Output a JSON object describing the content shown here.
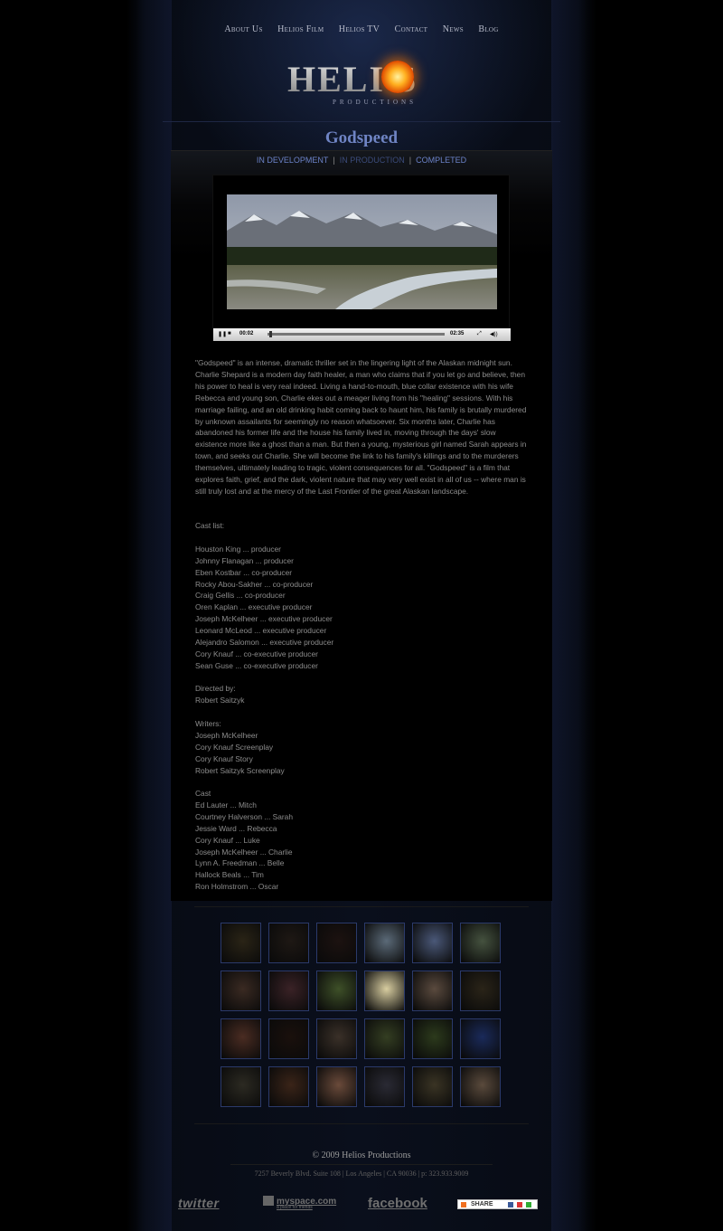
{
  "nav": {
    "items": [
      "About Us",
      "Helios Film",
      "Helios TV",
      "Contact",
      "News",
      "Blog"
    ]
  },
  "logo": {
    "word": "HELI  S",
    "sub": "PRODUCTIONS"
  },
  "page": {
    "title": "Godspeed"
  },
  "subnav": {
    "items": [
      "IN DEVELOPMENT",
      "IN PRODUCTION",
      "COMPLETED"
    ],
    "active_index": 1
  },
  "player": {
    "elapsed": "00:02",
    "duration": "02:35",
    "progress_fraction": 0.013
  },
  "description": "\"Godspeed\" is an intense, dramatic thriller set in the lingering light of the Alaskan midnight sun. Charlie Shepard is a modern day faith healer, a man who claims that if you let go and believe, then his power to heal is very real indeed. Living a hand-to-mouth, blue collar existence with his wife Rebecca and young son, Charlie ekes out a meager living from his \"healing\" sessions. With his marriage failing, and an old drinking habit coming back to haunt him, his family is brutally murdered by unknown assailants for seemingly no reason whatsoever. Six months later, Charlie has abandoned his former life and the house his family lived in, moving through the days' slow existence more like a ghost than a man. But then a young, mysterious girl named Sarah appears in town, and seeks out Charlie. She will become the link to his family's killings and to the murderers themselves, ultimately leading to tragic, violent consequences for all. \"Godspeed\" is a film that explores faith, grief, and the dark, violent nature that may very well exist in all of us -- where man is still truly lost and at the mercy of the Last Frontier of the great Alaskan landscape.",
  "cast_list": {
    "heading": "Cast list:",
    "items": [
      "Houston King ... producer",
      "Johnny Flanagan ... producer",
      "Eben Kostbar ... co-producer",
      "Rocky Abou-Sakher ... co-producer",
      "Craig Gellis ... co-producer",
      "Oren Kaplan ... executive producer",
      "Joseph McKelheer ... executive producer",
      "Leonard McLeod ... executive producer",
      "Alejandro Salomon ... executive producer",
      "Cory Knauf ... co-executive producer",
      "Sean Guse ... co-executive producer"
    ]
  },
  "directed": {
    "heading": "Directed by:",
    "items": [
      "Robert Saitzyk"
    ]
  },
  "writers": {
    "heading": "Writers:",
    "items": [
      "Joseph McKelheer",
      "Cory Knauf  Screenplay",
      "Cory Knauf  Story",
      "Robert Saitzyk  Screenplay"
    ]
  },
  "cast": {
    "heading": "Cast",
    "items": [
      "Ed Lauter ... Mitch",
      "Courtney Halverson ... Sarah",
      "Jessie Ward ... Rebecca",
      "Cory Knauf ... Luke",
      "Joseph McKelheer ... Charlie",
      "Lynn A. Freedman ... Belle",
      "Hallock Beals ... Tim",
      "Ron Holmstrom ... Oscar"
    ]
  },
  "gallery": {
    "colors": [
      [
        "#2a2416",
        "#1e1814",
        "#1c1210",
        "#5b6a78",
        "#4a5878",
        "#45523f"
      ],
      [
        "#3a2a22",
        "#3a2226",
        "#3e5028",
        "#d8cda0",
        "#5a4a3e",
        "#2a2418"
      ],
      [
        "#4a2c22",
        "#1a100c",
        "#3a3028",
        "#343e22",
        "#2c3a1c",
        "#1a2a5a"
      ],
      [
        "#2c2a22",
        "#3a2418",
        "#6a4a3a",
        "#2a2a34",
        "#3a3424",
        "#5a4a3c"
      ]
    ]
  },
  "footer": {
    "copyright": "© 2009 Helios Productions",
    "address": "7257 Beverly Blvd. Suite 108 | Los Angeles | CA 90036 | p: 323.933.9009",
    "twitter": "twitter",
    "myspace": "myspace.com",
    "myspace_tag": "a place for friends",
    "facebook": "facebook",
    "share": "SHARE"
  }
}
